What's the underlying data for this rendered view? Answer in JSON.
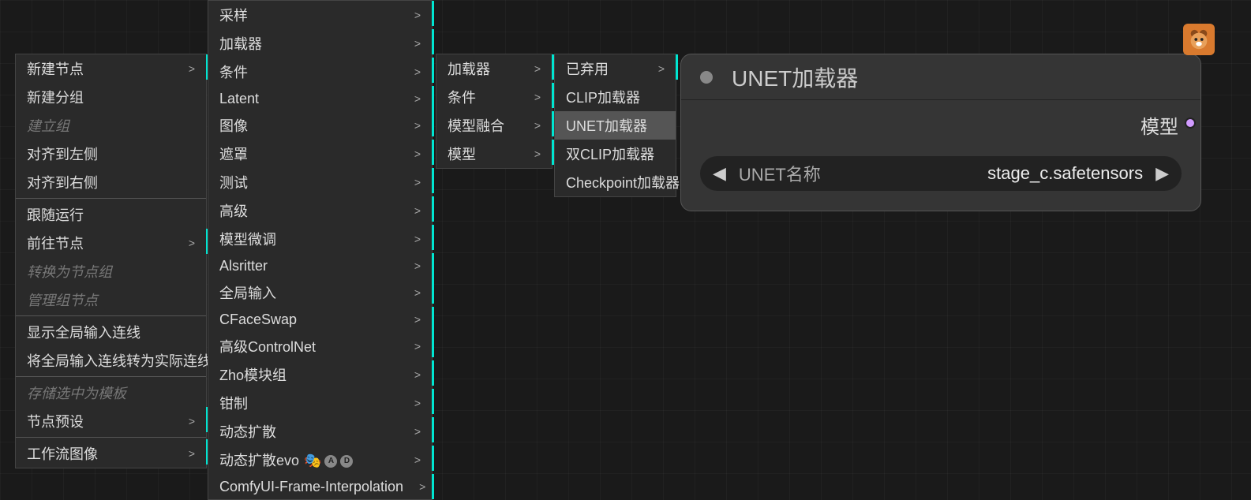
{
  "menu1": {
    "items": [
      {
        "label": "新建节点",
        "arrow": true,
        "accent": true
      },
      {
        "label": "新建分组"
      },
      {
        "label": "建立组",
        "disabled": true
      },
      {
        "label": "对齐到左侧"
      },
      {
        "label": "对齐到右侧"
      },
      {
        "divider": true
      },
      {
        "label": "跟随运行"
      },
      {
        "label": "前往节点",
        "arrow": true,
        "accent": true
      },
      {
        "label": "转换为节点组",
        "disabled": true
      },
      {
        "label": "管理组节点",
        "disabled": true
      },
      {
        "divider": true
      },
      {
        "label": "显示全局输入连线"
      },
      {
        "label": "将全局输入连线转为实际连线"
      },
      {
        "divider": true
      },
      {
        "label": "存储选中为模板",
        "disabled": true
      },
      {
        "label": "节点预设",
        "arrow": true,
        "accent": true
      },
      {
        "divider": true
      },
      {
        "label": "工作流图像",
        "arrow": true,
        "accent": true
      }
    ]
  },
  "menu2": {
    "items": [
      {
        "label": "采样",
        "arrow": true,
        "accent": true
      },
      {
        "label": "加载器",
        "arrow": true,
        "accent": true
      },
      {
        "label": "条件",
        "arrow": true,
        "accent": true
      },
      {
        "label": "Latent",
        "arrow": true,
        "accent": true
      },
      {
        "label": "图像",
        "arrow": true,
        "accent": true
      },
      {
        "label": "遮罩",
        "arrow": true,
        "accent": true
      },
      {
        "label": "测试",
        "arrow": true,
        "accent": true
      },
      {
        "label": "高级",
        "arrow": true,
        "accent": true,
        "active": true
      },
      {
        "label": "模型微调",
        "arrow": true,
        "accent": true
      },
      {
        "label": "Alsritter",
        "arrow": true,
        "accent": true
      },
      {
        "label": "全局输入",
        "arrow": true,
        "accent": true
      },
      {
        "label": "CFaceSwap",
        "arrow": true,
        "accent": true
      },
      {
        "label": "高级ControlNet",
        "arrow": true,
        "accent": true
      },
      {
        "label": "Zho模块组",
        "arrow": true,
        "accent": true
      },
      {
        "label": "钳制",
        "arrow": true,
        "accent": true
      },
      {
        "label": "动态扩散",
        "arrow": true,
        "accent": true
      },
      {
        "label": "动态扩散evo",
        "arrow": true,
        "accent": true,
        "badges": true
      },
      {
        "label": "ComfyUI-Frame-Interpolation",
        "arrow": true,
        "accent": true
      }
    ]
  },
  "menu3": {
    "items": [
      {
        "label": "加载器",
        "arrow": true,
        "accent": true,
        "active": true
      },
      {
        "label": "条件",
        "arrow": true,
        "accent": true
      },
      {
        "label": "模型融合",
        "arrow": true,
        "accent": true
      },
      {
        "label": "模型",
        "arrow": true,
        "accent": true
      }
    ]
  },
  "menu4": {
    "items": [
      {
        "label": "已弃用",
        "arrow": true,
        "accent": true
      },
      {
        "label": "CLIP加载器"
      },
      {
        "label": "UNET加载器",
        "hovered": true
      },
      {
        "label": "双CLIP加载器"
      },
      {
        "label": "Checkpoint加载器"
      }
    ]
  },
  "node": {
    "title": "UNET加载器",
    "output": "模型",
    "widget_label": "UNET名称",
    "widget_value": "stage_c.safetensors"
  },
  "badges": {
    "a": "A",
    "d": "D"
  }
}
